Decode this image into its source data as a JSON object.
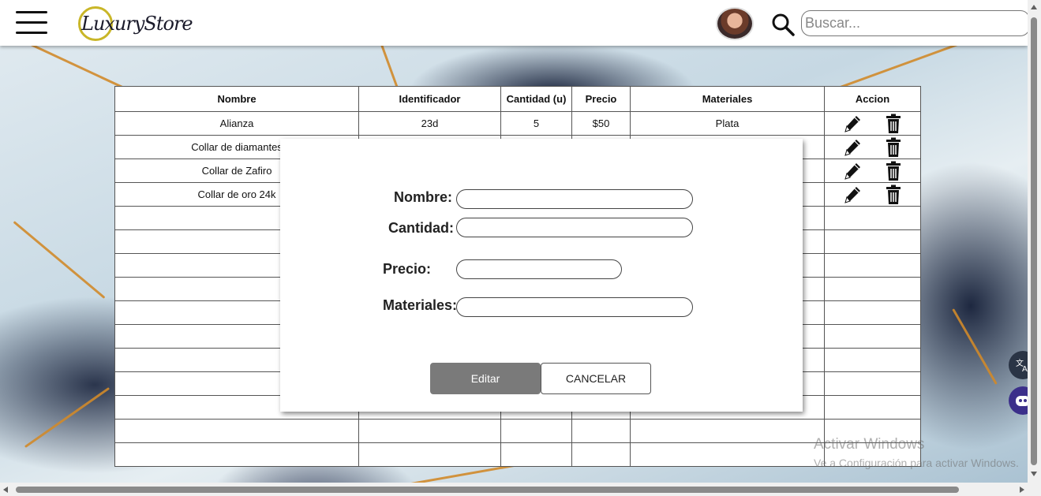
{
  "header": {
    "logo_text": "LuxuryStore",
    "search_placeholder": "Buscar..."
  },
  "table": {
    "headers": [
      "Nombre",
      "Identificador",
      "Cantidad (u)",
      "Precio",
      "Materiales",
      "Accion"
    ],
    "rows": [
      {
        "nombre": "Alianza",
        "identificador": "23d",
        "cantidad": "5",
        "precio": "$50",
        "materiales": "Plata",
        "actions": true
      },
      {
        "nombre": "Collar de diamantes",
        "identificador": "",
        "cantidad": "",
        "precio": "",
        "materiales": "",
        "actions": true
      },
      {
        "nombre": "Collar de Zafiro",
        "identificador": "",
        "cantidad": "",
        "precio": "",
        "materiales": "",
        "actions": true
      },
      {
        "nombre": "Collar de oro 24k",
        "identificador": "",
        "cantidad": "",
        "precio": "",
        "materiales": "",
        "actions": true
      },
      {
        "nombre": "",
        "identificador": "",
        "cantidad": "",
        "precio": "",
        "materiales": "",
        "actions": false
      },
      {
        "nombre": "",
        "identificador": "",
        "cantidad": "",
        "precio": "",
        "materiales": "",
        "actions": false
      },
      {
        "nombre": "",
        "identificador": "",
        "cantidad": "",
        "precio": "",
        "materiales": "",
        "actions": false
      },
      {
        "nombre": "",
        "identificador": "",
        "cantidad": "",
        "precio": "",
        "materiales": "",
        "actions": false
      },
      {
        "nombre": "",
        "identificador": "",
        "cantidad": "",
        "precio": "",
        "materiales": "",
        "actions": false
      },
      {
        "nombre": "",
        "identificador": "",
        "cantidad": "",
        "precio": "",
        "materiales": "",
        "actions": false
      },
      {
        "nombre": "",
        "identificador": "",
        "cantidad": "",
        "precio": "",
        "materiales": "",
        "actions": false
      },
      {
        "nombre": "",
        "identificador": "",
        "cantidad": "",
        "precio": "",
        "materiales": "",
        "actions": false
      },
      {
        "nombre": "",
        "identificador": "",
        "cantidad": "",
        "precio": "",
        "materiales": "",
        "actions": false
      },
      {
        "nombre": "",
        "identificador": "",
        "cantidad": "",
        "precio": "",
        "materiales": "",
        "actions": false
      },
      {
        "nombre": "",
        "identificador": "",
        "cantidad": "",
        "precio": "",
        "materiales": "",
        "actions": false
      }
    ]
  },
  "modal": {
    "nombre_label": "Nombre:",
    "cantidad_label": "Cantidad:",
    "precio_label": "Precio:",
    "materiales_label": "Materiales:",
    "nombre_value": "",
    "cantidad_value": "",
    "precio_value": "",
    "materiales_value": "",
    "edit_button": "Editar",
    "cancel_button": "CANCELAR"
  },
  "watermark": {
    "line1": "Activar Windows",
    "line2": "Ve a Configuración para activar Windows."
  },
  "widgets": {
    "translate_icon": "translate-icon",
    "assistant_icon": "assistant-icon"
  },
  "colors": {
    "logo_ring": "#c9b628",
    "edit_button_bg": "#7a7a7a",
    "vein": "#d08a2a"
  }
}
